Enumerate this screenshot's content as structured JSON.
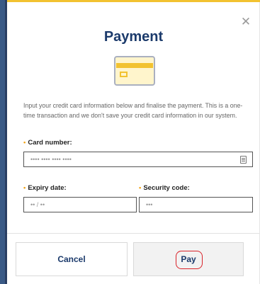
{
  "modal": {
    "title": "Payment",
    "description": "Input your credit card information below and finalise the payment. This is a one-time transaction and we don't save your credit card information in our system.",
    "close_icon": "close-icon"
  },
  "fields": {
    "card_number": {
      "label": "Card number:",
      "placeholder": "•••• •••• •••• ••••"
    },
    "expiry_date": {
      "label": "Expiry date:",
      "placeholder": "•• / ••"
    },
    "security_code": {
      "label": "Security code:",
      "placeholder": "•••"
    },
    "required_mark": "•"
  },
  "buttons": {
    "cancel_label": "Cancel",
    "pay_label": "Pay"
  },
  "colors": {
    "title": "#1b3a6b",
    "accent_yellow": "#f2c230",
    "required": "#f2a51a",
    "pay_annotation": "#d9232a"
  }
}
